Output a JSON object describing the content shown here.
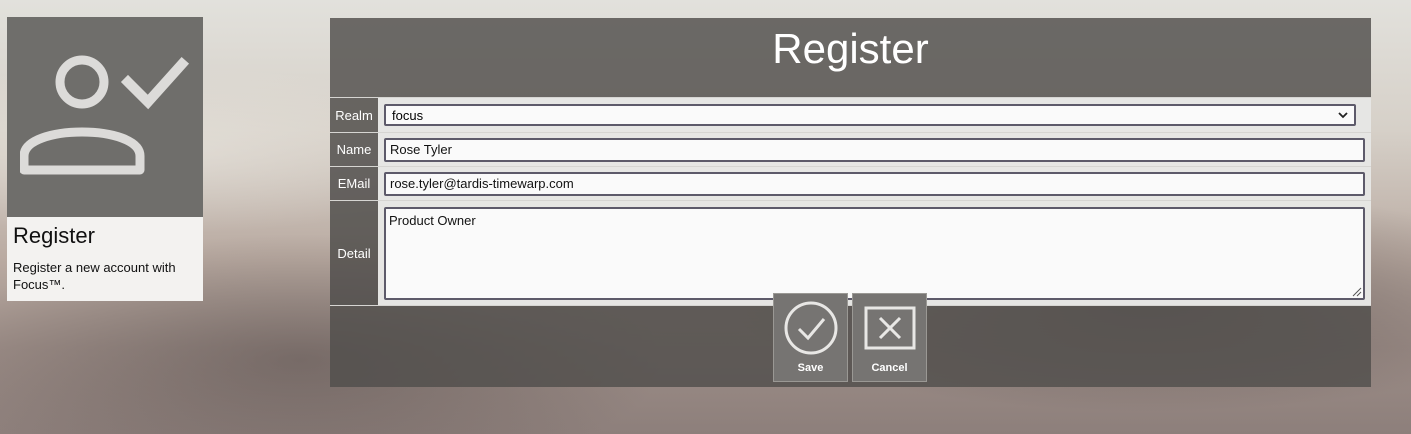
{
  "card": {
    "icon": "user-check-icon",
    "title": "Register",
    "description": "Register a new account with Focus™."
  },
  "form": {
    "title": "Register",
    "fields": {
      "realm": {
        "label": "Realm",
        "value": "focus"
      },
      "name": {
        "label": "Name",
        "value": "Rose Tyler"
      },
      "email": {
        "label": "EMail",
        "value": "rose.tyler@tardis-timewarp.com"
      },
      "detail": {
        "label": "Detail",
        "value": "Product Owner"
      }
    },
    "buttons": {
      "save": {
        "label": "Save",
        "icon": "check-circle-icon"
      },
      "cancel": {
        "label": "Cancel",
        "icon": "x-box-icon"
      }
    }
  }
}
